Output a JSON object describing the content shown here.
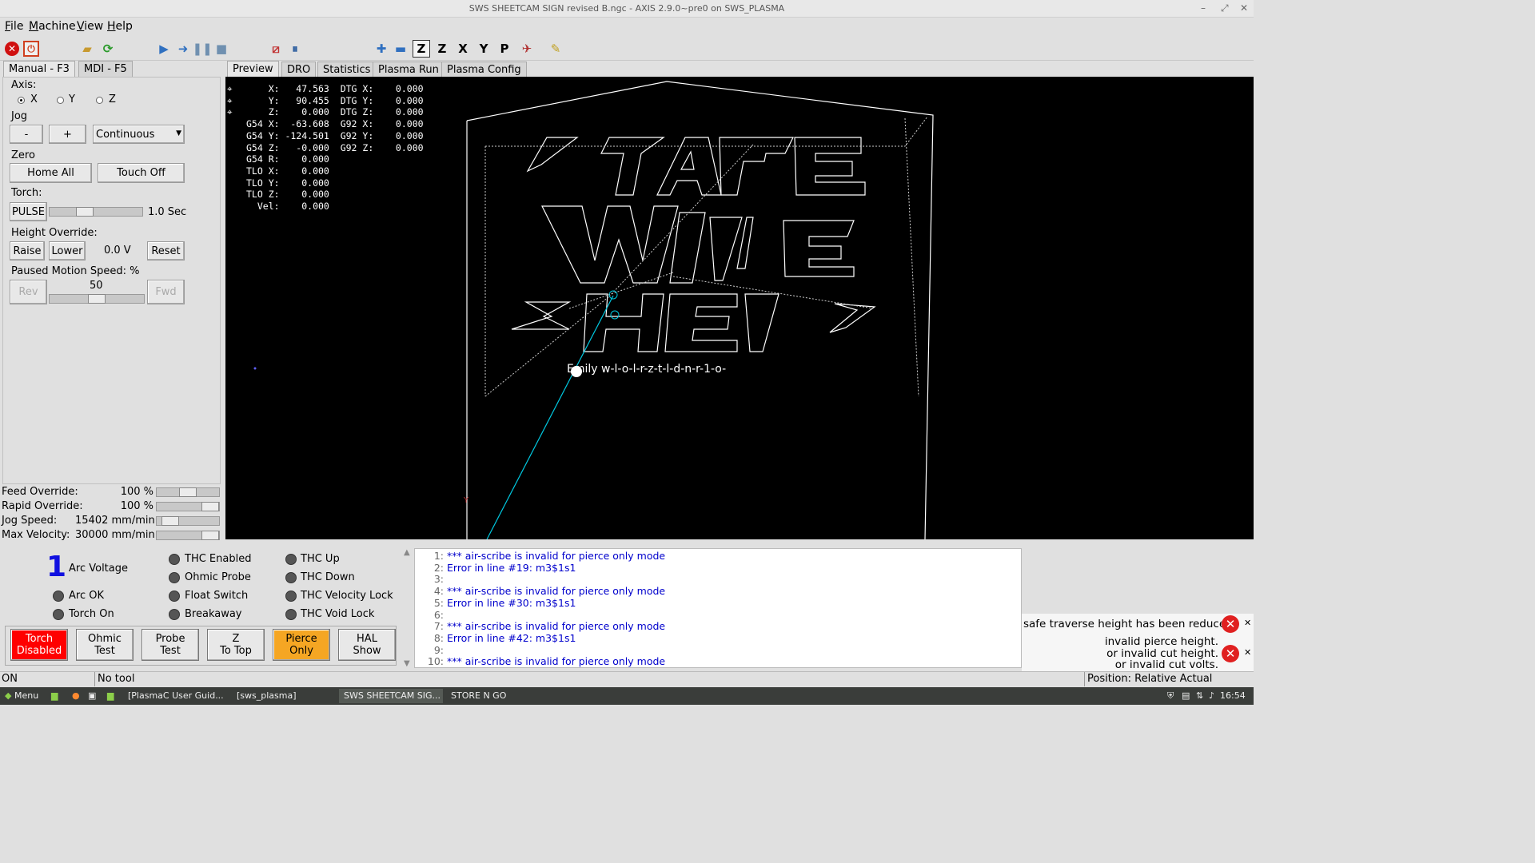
{
  "window": {
    "title": "SWS SHEETCAM SIGN revised B.ngc - AXIS 2.9.0~pre0 on SWS_PLASMA",
    "controls": [
      "–",
      "⤢",
      "✕"
    ]
  },
  "menu": [
    {
      "label": "File",
      "u": "F"
    },
    {
      "label": "Machine",
      "u": "M"
    },
    {
      "label": "View",
      "u": "V"
    },
    {
      "label": "Help",
      "u": "H"
    }
  ],
  "toolbar_icons": [
    "estop-icon",
    "power-icon",
    "open-file-icon",
    "reload-icon",
    "run-icon",
    "step-icon",
    "pause-icon",
    "stop-icon",
    "block-delete-icon",
    "optional-stop-icon",
    "zoom-in-icon",
    "zoom-out-icon",
    "view-z-icon",
    "view-z2-icon",
    "view-x-icon",
    "view-y-icon",
    "view-p-icon",
    "rotate-icon",
    "clear-plot-icon"
  ],
  "toolbar_letters": {
    "z": "Z",
    "z2": "Z",
    "x": "X",
    "y": "Y",
    "p": "P"
  },
  "left_tabs": [
    "Manual - F3",
    "MDI - F5"
  ],
  "right_tabs": [
    "Preview",
    "DRO",
    "Statistics",
    "Plasma Run",
    "Plasma Config"
  ],
  "manual": {
    "axis_label": "Axis:",
    "axes": [
      "X",
      "Y",
      "Z"
    ],
    "selected_axis": "X",
    "jog_label": "Jog",
    "jog_minus": "-",
    "jog_plus": "+",
    "jog_mode": "Continuous",
    "zero_label": "Zero",
    "home_all": "Home All",
    "touch_off": "Touch Off",
    "torch_label": "Torch:",
    "pulse": "PULSE",
    "pulse_time": "1.0 Sec",
    "pulse_level": 0.35,
    "height_override_label": "Height Override:",
    "raise": "Raise",
    "lower": "Lower",
    "height_value": "0.0 V",
    "reset": "Reset",
    "paused_speed_label": "Paused Motion Speed: %",
    "paused_speed_value": "50",
    "paused_speed_level": 0.5,
    "rev": "Rev",
    "fwd": "Fwd"
  },
  "overrides": [
    {
      "label": "Feed Override:",
      "value": "100 %",
      "level": 0.5
    },
    {
      "label": "Rapid Override:",
      "value": "100 %",
      "level": 1.0
    },
    {
      "label": "Jog Speed:",
      "value": "15402 mm/min",
      "level": 0.1
    },
    {
      "label": "Max Velocity:",
      "value": "30000 mm/min",
      "level": 1.0
    }
  ],
  "dro": [
    "    X:   47.563  DTG X:    0.000",
    "    Y:   90.455  DTG Y:    0.000",
    "    Z:    0.000  DTG Z:    0.000",
    "G54 X:  -63.608  G92 X:    0.000",
    "G54 Y: -124.501  G92 Y:    0.000",
    "G54 Z:   -0.000  G92 Z:    0.000",
    "G54 R:    0.000",
    "TLO X:    0.000",
    "TLO Y:    0.000",
    "TLO Z:    0.000",
    "  Vel:    0.000"
  ],
  "preview_caption": "Emily  w-l-o-l-r-z-t-l-d-n-r-1-o-",
  "plasma": {
    "arc_voltage_value": "1",
    "arc_voltage_label": "Arc Voltage",
    "leds_col1": [
      "Arc OK",
      "Torch On"
    ],
    "leds_col2": [
      "THC Enabled",
      "Ohmic Probe",
      "Float Switch",
      "Breakaway"
    ],
    "leds_col3": [
      "THC Up",
      "THC Down",
      "THC Velocity Lock",
      "THC Void Lock"
    ],
    "buttons": [
      {
        "l1": "Torch",
        "l2": "Disabled",
        "color": "#ff0000"
      },
      {
        "l1": "Ohmic",
        "l2": "Test",
        "color": ""
      },
      {
        "l1": "Probe",
        "l2": "Test",
        "color": ""
      },
      {
        "l1": "Z",
        "l2": "To Top",
        "color": ""
      },
      {
        "l1": "Pierce",
        "l2": "Only",
        "color": "#f5a623"
      },
      {
        "l1": "HAL",
        "l2": "Show",
        "color": ""
      }
    ]
  },
  "gcode_lines": [
    {
      "n": "1:",
      "text": "*** air-scribe is invalid for pierce only mode"
    },
    {
      "n": "2:",
      "text": "Error in line #19: m3$1s1"
    },
    {
      "n": "3:",
      "text": ""
    },
    {
      "n": "4:",
      "text": "*** air-scribe is invalid for pierce only mode"
    },
    {
      "n": "5:",
      "text": "Error in line #30: m3$1s1"
    },
    {
      "n": "6:",
      "text": ""
    },
    {
      "n": "7:",
      "text": "*** air-scribe is invalid for pierce only mode"
    },
    {
      "n": "8:",
      "text": "Error in line #42: m3$1s1"
    },
    {
      "n": "9:",
      "text": ""
    },
    {
      "n": "10:",
      "text": "*** air-scribe is invalid for pierce only mode"
    }
  ],
  "notifications": {
    "first": "safe traverse height has been reduced.",
    "second": [
      "invalid pierce height.",
      "or invalid cut height.",
      "or invalid cut volts."
    ]
  },
  "status": {
    "machine": "ON",
    "tool": "No tool",
    "position": "Position: Relative Actual"
  },
  "taskbar": {
    "menu": "Menu",
    "tasks": [
      "[PlasmaC User Guid...",
      "[sws_plasma]",
      "SWS SHEETCAM SIG...",
      "STORE N GO"
    ],
    "clock": "16:54"
  }
}
